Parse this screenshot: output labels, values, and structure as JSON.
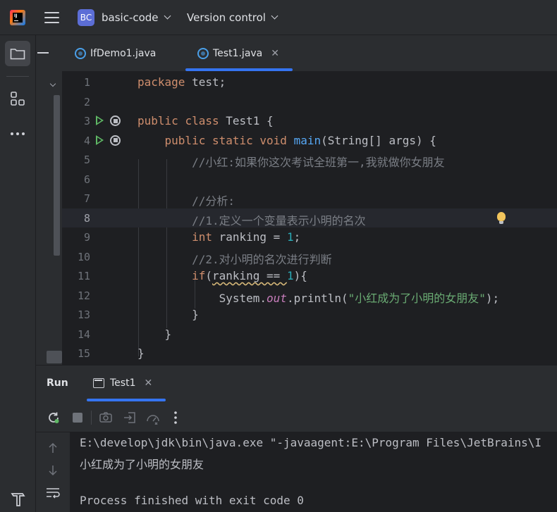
{
  "titlebar": {
    "project_badge": "BC",
    "project_name": "basic-code",
    "vcs_label": "Version control"
  },
  "tabs": [
    {
      "label": "IfDemo1.java",
      "active": false
    },
    {
      "label": "Test1.java",
      "active": true,
      "close": "✕"
    }
  ],
  "editor": {
    "current_line": 8,
    "line_numbers": [
      "1",
      "2",
      "3",
      "4",
      "5",
      "6",
      "7",
      "8",
      "9",
      "10",
      "11",
      "12",
      "13",
      "14",
      "15"
    ],
    "tokens": {
      "l1_kw": "package",
      "l1_rest": " test;",
      "l3_kw1": "public",
      "l3_kw2": "class",
      "l3_rest": " Test1 {",
      "l4_kw1": "public",
      "l4_kw2": "static",
      "l4_kw3": "void",
      "l4_fn": "main",
      "l4_rest": "(String[] args) {",
      "l5_cmt": "//小红:如果你这次考试全班第一,我就做你女朋友",
      "l7_cmt": "//分析:",
      "l8_cmt": "//1.定义一个变量表示小明的名次",
      "l9_kw": "int",
      "l9_a": " ranking = ",
      "l9_num": "1",
      "l9_b": ";",
      "l10_cmt": "//2.对小明的名次进行判断",
      "l11_kw": "if",
      "l11_a": "(",
      "l11_sq": "ranking == ",
      "l11_num": "1",
      "l11_b": "){",
      "l12_a": "System.",
      "l12_out": "out",
      "l12_b": ".println(",
      "l12_str": "\"小红成为了小明的女朋友\"",
      "l12_c": ");",
      "l13": "}",
      "l14": "}",
      "l15": "}"
    }
  },
  "run_panel": {
    "title": "Run",
    "tab_label": "Test1",
    "tab_close": "✕",
    "console": [
      "E:\\develop\\jdk\\bin\\java.exe \"-javaagent:E:\\Program Files\\JetBrains\\I",
      "小红成为了小明的女朋友",
      "",
      "Process finished with exit code 0"
    ]
  },
  "colors": {
    "accent": "#3574f0",
    "keyword": "#cf8e6d",
    "function": "#56a8f5",
    "string": "#6aab73",
    "number": "#2aacb8",
    "comment": "#7a7e85"
  }
}
